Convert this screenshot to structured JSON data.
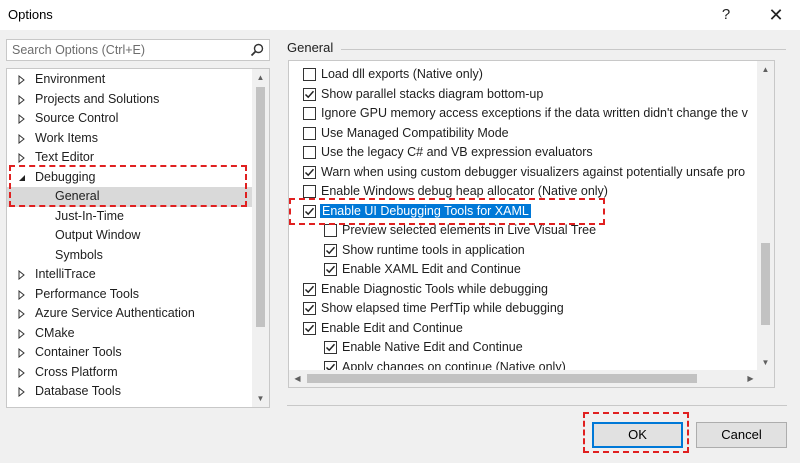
{
  "window": {
    "title": "Options",
    "help_glyph": "?",
    "close_glyph": "✕"
  },
  "search": {
    "placeholder": "Search Options (Ctrl+E)"
  },
  "tree": {
    "items": [
      {
        "label": "Environment",
        "level": 0,
        "expanded": false,
        "selected": false
      },
      {
        "label": "Projects and Solutions",
        "level": 0,
        "expanded": false,
        "selected": false
      },
      {
        "label": "Source Control",
        "level": 0,
        "expanded": false,
        "selected": false
      },
      {
        "label": "Work Items",
        "level": 0,
        "expanded": false,
        "selected": false
      },
      {
        "label": "Text Editor",
        "level": 0,
        "expanded": false,
        "selected": false
      },
      {
        "label": "Debugging",
        "level": 0,
        "expanded": true,
        "selected": false
      },
      {
        "label": "General",
        "level": 1,
        "expanded": null,
        "selected": true
      },
      {
        "label": "Just-In-Time",
        "level": 1,
        "expanded": null,
        "selected": false
      },
      {
        "label": "Output Window",
        "level": 1,
        "expanded": null,
        "selected": false
      },
      {
        "label": "Symbols",
        "level": 1,
        "expanded": null,
        "selected": false
      },
      {
        "label": "IntelliTrace",
        "level": 0,
        "expanded": false,
        "selected": false
      },
      {
        "label": "Performance Tools",
        "level": 0,
        "expanded": false,
        "selected": false
      },
      {
        "label": "Azure Service Authentication",
        "level": 0,
        "expanded": false,
        "selected": false
      },
      {
        "label": "CMake",
        "level": 0,
        "expanded": false,
        "selected": false
      },
      {
        "label": "Container Tools",
        "level": 0,
        "expanded": false,
        "selected": false
      },
      {
        "label": "Cross Platform",
        "level": 0,
        "expanded": false,
        "selected": false
      },
      {
        "label": "Database Tools",
        "level": 0,
        "expanded": false,
        "selected": false
      }
    ]
  },
  "panel": {
    "title": "General",
    "options": [
      {
        "label": "Load dll exports (Native only)",
        "checked": false,
        "level": 0,
        "selected": false
      },
      {
        "label": "Show parallel stacks diagram bottom-up",
        "checked": true,
        "level": 0,
        "selected": false
      },
      {
        "label": "Ignore GPU memory access exceptions if the data written didn't change the v",
        "checked": false,
        "level": 0,
        "selected": false
      },
      {
        "label": "Use Managed Compatibility Mode",
        "checked": false,
        "level": 0,
        "selected": false
      },
      {
        "label": "Use the legacy C# and VB expression evaluators",
        "checked": false,
        "level": 0,
        "selected": false
      },
      {
        "label": "Warn when using custom debugger visualizers against potentially unsafe pro",
        "checked": true,
        "level": 0,
        "selected": false
      },
      {
        "label": "Enable Windows debug heap allocator (Native only)",
        "checked": false,
        "level": 0,
        "selected": false
      },
      {
        "label": "Enable UI Debugging Tools for XAML",
        "checked": true,
        "level": 0,
        "selected": true
      },
      {
        "label": "Preview selected elements in Live Visual Tree",
        "checked": false,
        "level": 1,
        "selected": false
      },
      {
        "label": "Show runtime tools in application",
        "checked": true,
        "level": 1,
        "selected": false
      },
      {
        "label": "Enable XAML Edit and Continue",
        "checked": true,
        "level": 1,
        "selected": false
      },
      {
        "label": "Enable Diagnostic Tools while debugging",
        "checked": true,
        "level": 0,
        "selected": false
      },
      {
        "label": "Show elapsed time PerfTip while debugging",
        "checked": true,
        "level": 0,
        "selected": false
      },
      {
        "label": "Enable Edit and Continue",
        "checked": true,
        "level": 0,
        "selected": false
      },
      {
        "label": "Enable Native Edit and Continue",
        "checked": true,
        "level": 1,
        "selected": false
      },
      {
        "label": "Apply changes on continue (Native only)",
        "checked": true,
        "level": 1,
        "selected": false
      }
    ]
  },
  "buttons": {
    "ok_label": "OK",
    "cancel_label": "Cancel"
  },
  "colors": {
    "selection": "#0078d7",
    "highlight_dash": "#e02020",
    "tree_selected": "#d9d9d9"
  },
  "icons": [
    "search-icon",
    "expand-arrow-icon",
    "collapse-arrow-icon",
    "checkbox-check-icon",
    "help-icon",
    "close-icon"
  ]
}
